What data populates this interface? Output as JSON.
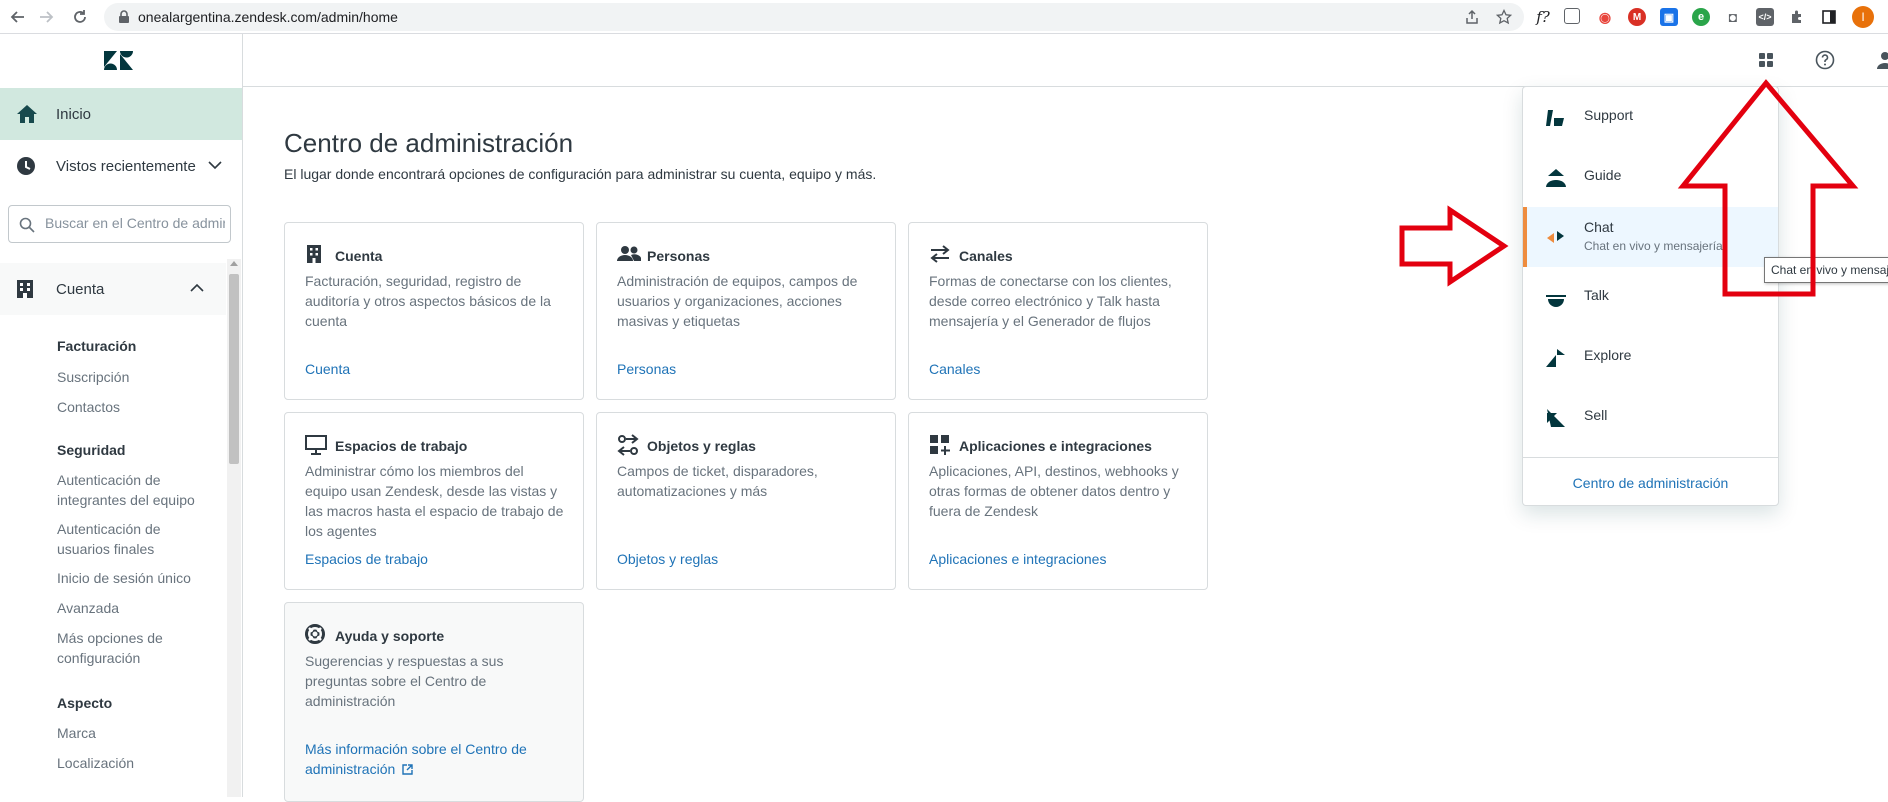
{
  "browser": {
    "url": "onealargentina.zendesk.com/admin/home",
    "profile_initial": "I"
  },
  "sidebar": {
    "home_label": "Inicio",
    "recent_label": "Vistos recientemente",
    "search_placeholder": "Buscar en el Centro de administración",
    "account_label": "Cuenta",
    "groups": [
      {
        "heading": "Facturación",
        "links": [
          "Suscripción",
          "Contactos"
        ]
      },
      {
        "heading": "Seguridad",
        "links": [
          "Autenticación de integrantes del equipo",
          "Autenticación de usuarios finales",
          "Inicio de sesión único",
          "Avanzada",
          "Más opciones de configuración"
        ]
      },
      {
        "heading": "Aspecto",
        "links": [
          "Marca",
          "Localización"
        ]
      }
    ]
  },
  "main": {
    "title": "Centro de administración",
    "subtitle": "El lugar donde encontrará opciones de configuración para administrar su cuenta, equipo y más.",
    "cards": [
      {
        "title": "Cuenta",
        "icon": "building-icon",
        "desc": "Facturación, seguridad, registro de auditoría y otros aspectos básicos de la cuenta",
        "link": "Cuenta"
      },
      {
        "title": "Personas",
        "icon": "people-icon",
        "desc": "Administración de equipos, campos de usuarios y organizaciones, acciones masivas y etiquetas",
        "link": "Personas"
      },
      {
        "title": "Canales",
        "icon": "arrows-exchange-icon",
        "desc": "Formas de conectarse con los clientes, desde correo electrónico y Talk hasta mensajería y el Generador de flujos",
        "link": "Canales"
      },
      {
        "title": "Espacios de trabajo",
        "icon": "monitor-icon",
        "desc": "Administrar cómo los miembros del equipo usan Zendesk, desde las vistas y las macros hasta el espacio de trabajo de los agentes",
        "link": "Espacios de trabajo"
      },
      {
        "title": "Objetos y reglas",
        "icon": "objects-rules-icon",
        "desc": "Campos de ticket, disparadores, automatizaciones y más",
        "link": "Objetos y reglas"
      },
      {
        "title": "Aplicaciones e integraciones",
        "icon": "apps-grid-icon",
        "desc": "Aplicaciones, API, destinos, webhooks y otras formas de obtener datos dentro y fuera de Zendesk",
        "link": "Aplicaciones e integraciones"
      },
      {
        "title": "Ayuda y soporte",
        "icon": "lifebuoy-icon",
        "desc": "Sugerencias y respuestas a sus preguntas sobre el Centro de administración",
        "link": "Más información sobre el Centro de administración"
      }
    ]
  },
  "tray": {
    "items": [
      {
        "label": "Support",
        "sub": ""
      },
      {
        "label": "Guide",
        "sub": ""
      },
      {
        "label": "Chat",
        "sub": "Chat en vivo y mensajería"
      },
      {
        "label": "Talk",
        "sub": ""
      },
      {
        "label": "Explore",
        "sub": ""
      },
      {
        "label": "Sell",
        "sub": ""
      }
    ],
    "footer": "Centro de administración"
  },
  "tooltip": "Chat en vivo y mensajería",
  "colors": {
    "link": "#1f73b7",
    "active_nav_bg": "#d1e8df",
    "chat_accent": "#ee8c3e",
    "annotation_arrow": "#e3000f"
  }
}
